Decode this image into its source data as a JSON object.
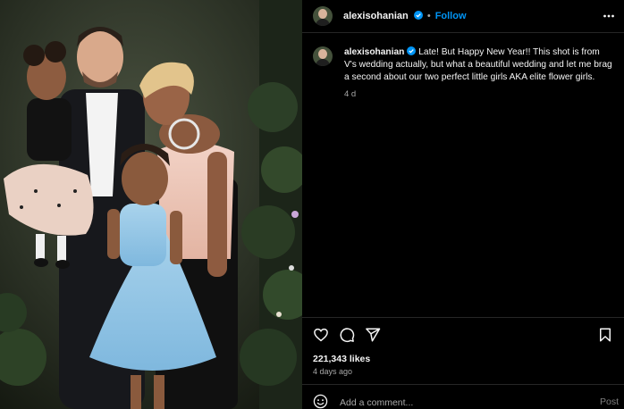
{
  "post": {
    "author": "alexisohanian",
    "verified": true,
    "follow_label": "Follow",
    "separator": "•",
    "caption_text": "Late! But Happy New Year!! This shot is from V's wedding actually, but what a beautiful wedding and let me brag a second about our two perfect little girls AKA elite flower girls.",
    "caption_time": "4 d",
    "likes": "221,343 likes",
    "posted_ago": "4 days ago"
  },
  "media": {
    "description_icon": "photo-family-portrait"
  },
  "actions": {
    "like_icon": "heart-icon",
    "comment_icon": "comment-icon",
    "share_icon": "share-icon",
    "save_icon": "bookmark-icon"
  },
  "comment": {
    "placeholder": "Add a comment...",
    "post_label": "Post"
  },
  "colors": {
    "background": "#000000",
    "text": "#f5f5f5",
    "secondary_text": "#a8a8a8",
    "accent": "#0095f6",
    "divider": "#262626"
  }
}
